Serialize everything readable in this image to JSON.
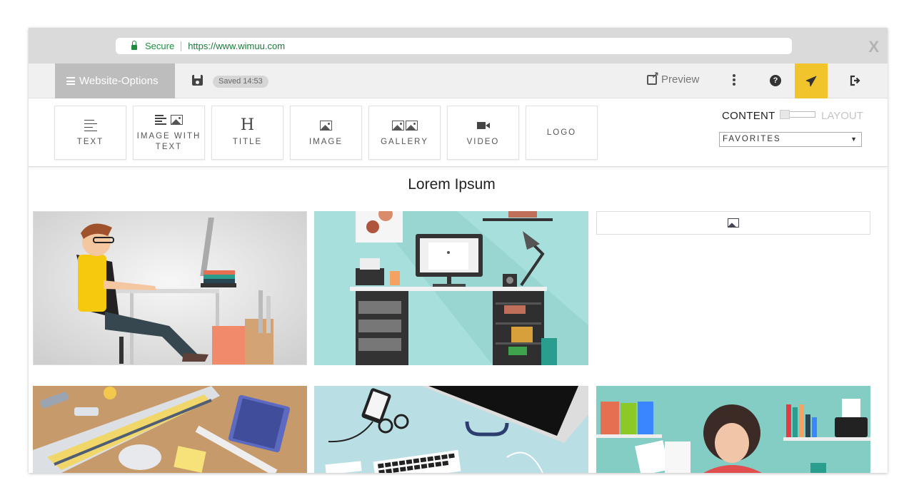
{
  "browser": {
    "secure_label": "Secure",
    "url": "https://www.wimuu.com",
    "close_label": "X"
  },
  "toolbar": {
    "website_options_label": "Website-Options",
    "saved_label": "Saved 14:53",
    "preview_label": "Preview",
    "help_glyph": "?",
    "accent_color": "#f2c42b"
  },
  "palette": {
    "tiles": [
      {
        "label": "TEXT",
        "icon": "text-icon"
      },
      {
        "label": "IMAGE WITH TEXT",
        "icon": "image-with-text-icon"
      },
      {
        "label": "TITLE",
        "icon": "title-icon"
      },
      {
        "label": "IMAGE",
        "icon": "image-icon"
      },
      {
        "label": "GALLERY",
        "icon": "gallery-icon"
      },
      {
        "label": "VIDEO",
        "icon": "video-icon"
      },
      {
        "label": "LOGO",
        "icon": ""
      }
    ],
    "title_glyph": "H",
    "content_label": "CONTENT",
    "layout_label": "LAYOUT",
    "select_value": "FAVORITES",
    "select_arrow": "▼"
  },
  "main": {
    "title": "Lorem Ipsum",
    "images": [
      "designer-at-desk-illustration",
      "teal-office-desk-illustration",
      "image-placeholder",
      "wooden-desk-monitor-illustration",
      "blue-desk-keyboard-illustration",
      "woman-office-shelves-illustration"
    ]
  }
}
